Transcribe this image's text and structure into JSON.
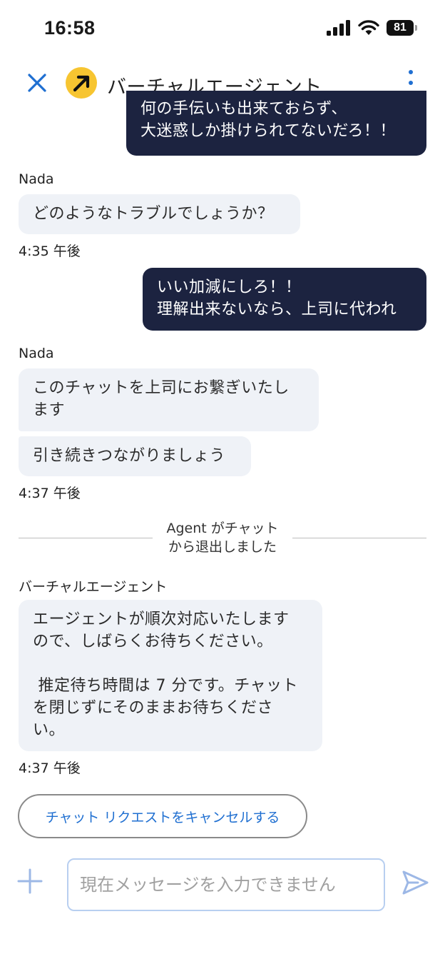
{
  "status_bar": {
    "time": "16:58",
    "battery": "81"
  },
  "header": {
    "title": "バーチャルエージェント"
  },
  "colors": {
    "accent": "#1f6fd1",
    "user_bubble": "#1c2340",
    "agent_bubble": "#eff2f7",
    "avatar": "#f7c531"
  },
  "messages": {
    "m1": {
      "line1": "何の手伝いも出来ておらず、",
      "line2": "大迷惑しか掛けられてないだろ！！"
    },
    "nada_label_1": "Nada",
    "m2": "どのようなトラブルでしょうか？",
    "time_1": "4:35 午後",
    "m3": {
      "line1": "いい加減にしろ！！",
      "line2": "理解出来ないなら、上司に代われ"
    },
    "nada_label_2": "Nada",
    "m4": {
      "line1": "このチャットを上司にお繋ぎいたし",
      "line2": "ます"
    },
    "m5": "引き続きつながりましょう",
    "time_2": "4:37 午後",
    "system": {
      "line1": "Agent がチャット",
      "line2": "から退出しました"
    },
    "va_label": "バーチャルエージェント",
    "m6": {
      "line1": "エージェントが順次対応いたします",
      "line2": "ので、しばらくお待ちください。",
      "line3": " 推定待ち時間は 7 分です。チャット",
      "line4": "を閉じずにそのままお待ちくださ",
      "line5": "い。"
    },
    "time_3": "4:37 午後"
  },
  "cancel_button": "チャット リクエストをキャンセルする",
  "composer": {
    "placeholder": "現在メッセージを入力できません"
  }
}
